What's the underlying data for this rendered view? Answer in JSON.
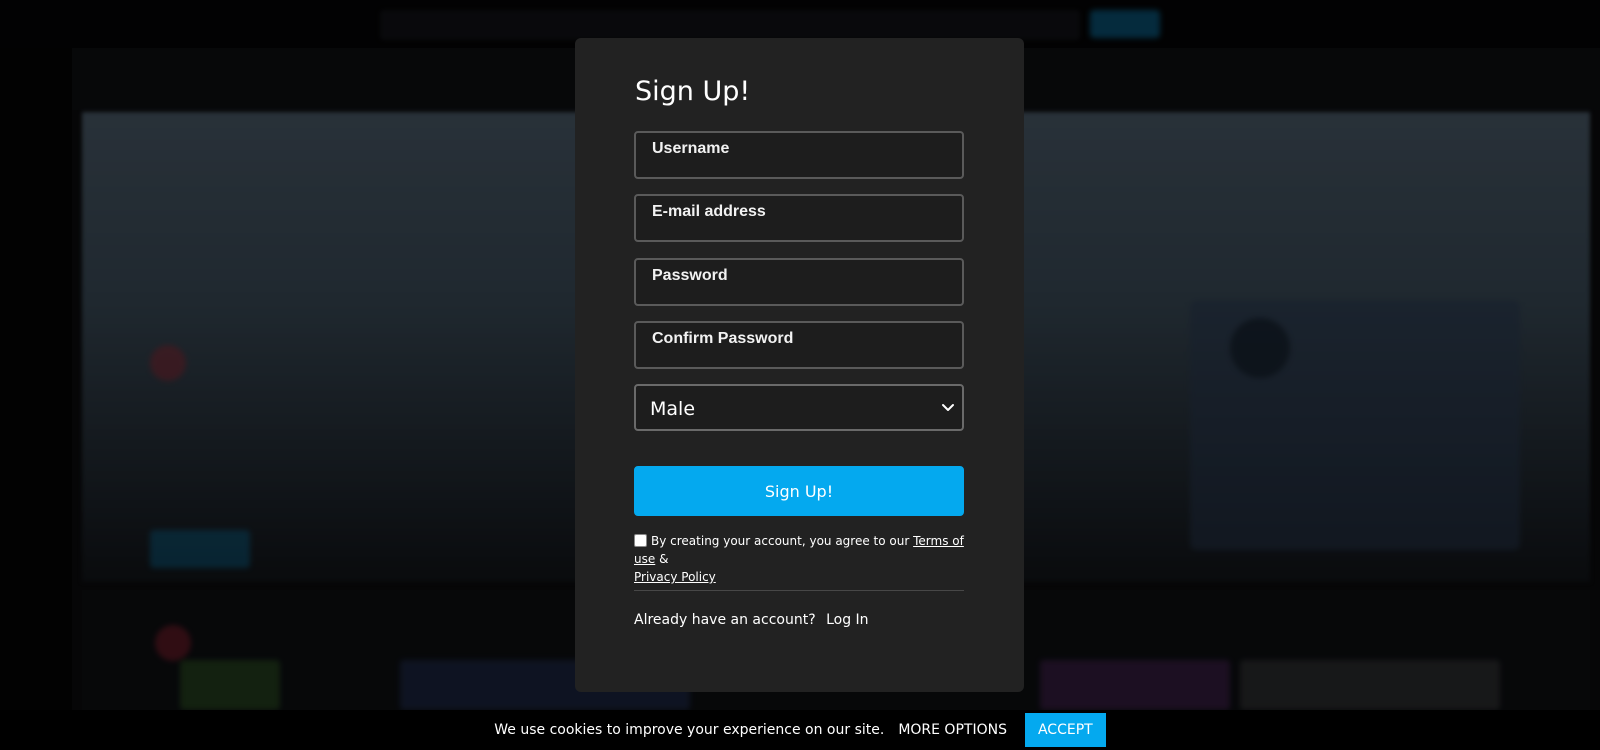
{
  "signup": {
    "title": "Sign Up!",
    "username_placeholder": "Username",
    "email_placeholder": "E-mail address",
    "password_placeholder": "Password",
    "confirm_password_placeholder": "Confirm Password",
    "gender_selected": "Male",
    "submit_label": "Sign Up!",
    "terms_text": "By creating your account, you agree to our",
    "terms_link": "Terms of use",
    "terms_and": "&",
    "privacy_link": "Privacy Policy",
    "terms_checked": false
  },
  "login": {
    "prompt": "Already have an account?",
    "link_label": "Log In"
  },
  "cookie_bar": {
    "message": "We use cookies to improve your experience on our site.",
    "more_options_label": "MORE OPTIONS",
    "accept_label": "ACCEPT"
  },
  "colors": {
    "accent": "#04a9ef",
    "modal_bg": "#222222",
    "field_bg": "#1d1d1d"
  },
  "icons": {
    "select_chevron": "chevron-down-icon"
  }
}
